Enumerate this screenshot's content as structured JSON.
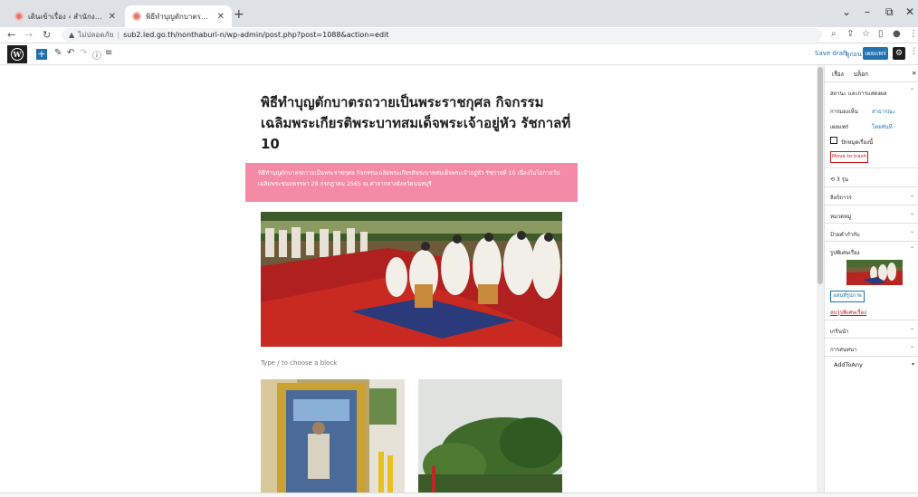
{
  "browser": {
    "tabs": [
      {
        "title": "เดินเข้าเรื่อง ‹ สำนักงานบังคับคดีจังหวัด"
      },
      {
        "title": "พิธีทำบุญตักบาตรถวายเป็นพระราชกุศล"
      }
    ],
    "security_label": "ไม่ปลอดภัย",
    "url": "sub2.led.go.th/nonthaburi-n/wp-admin/post.php?post=1088&action=edit"
  },
  "toolbar": {
    "save_draft": "Save draft",
    "preview": "ดูก่อน",
    "publish": "เผยแพร่"
  },
  "post": {
    "title": "พิธีทำบุญตักบาตรถวายเป็นพระราชกุศล กิจกรรมเฉลิมพระเกียรติพระบาทสมเด็จพระเจ้าอยู่หัว รัชกาลที่ 10",
    "excerpt": "พิธีทำบุญตักบาตรถวายเป็นพระราชกุศล กิจกรรมเฉลิมพระเกียรติพระบาทสมเด็จพระเจ้าอยู่หัว รัชกาลที่ 10 เนื่องในโอกาสวันเฉลิมพระชนมพรรษา 28 กรกฎาคม 2565 ณ ศาลากลางจังหวัดนนทบุรี",
    "block_placeholder": "Type / to choose a block"
  },
  "sidebar": {
    "tab_post": "เรื่อง",
    "tab_block": "บล็อก",
    "status_header": "สถานะ และการแสดงผล",
    "visibility_label": "การมองเห็น",
    "visibility_value": "สาธารณะ",
    "publish_label": "เผยแพร่",
    "publish_value": "โดยทันที",
    "sticky_label": "ปักหมุดเรื่องนี้",
    "trash_button": "Move to trash",
    "revisions": "3 รุ่น",
    "panels": [
      "ลิงก์ถาวร",
      "หมวดหมู่",
      "ป้ายคำกำกับ",
      "รูปพิเศษเรื่อง",
      "เกริ่นนำ",
      "การสนทนา",
      "AddToAny"
    ],
    "replace_image_button": "แทนที่รูปภาพ",
    "remove_image_link": "ลบรูปพิเศษเรื่อง"
  },
  "colors": {
    "accent": "#2271b1",
    "excerpt_bg": "#f48aa6",
    "trash": "#cc1818"
  }
}
